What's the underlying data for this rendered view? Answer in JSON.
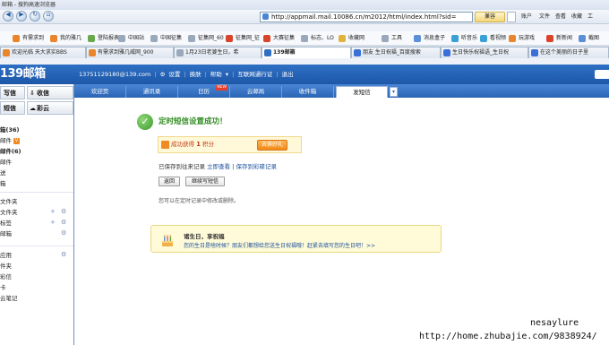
{
  "browser": {
    "window_title": "邮箱 - 搜狗高速浏览器",
    "address": "http://appmail.mail.10086.cn/m2012/html/index.html?sid=",
    "compat_label": "兼容",
    "menu": [
      "账户",
      "文件",
      "查看",
      "收藏",
      "工"
    ],
    "bookmarks": [
      "有需求到",
      "我的雅几",
      "登陆报表",
      "中国站",
      "中国征集",
      "征集网_60",
      "征集网_征",
      "大赛征集",
      "标志、LO",
      "收藏网",
      "工具",
      "消息盒子",
      "听音乐",
      "看视频",
      "玩游戏",
      "新新闻",
      "截图"
    ],
    "tabs": [
      "欢迎光临 天大求实BBS",
      "有需求到雅几威网_900",
      "1月23日老婆生日，希",
      "139邮箱",
      "朋友 生日祝福_百度搜索",
      "生日快乐祝福语_生日祝",
      "在这个美丽的日子里"
    ],
    "colors": {
      "accent": "#2f70c4",
      "success": "#3c9b2a"
    }
  },
  "mail": {
    "logo": "139邮箱",
    "account": "13751129180@139.com",
    "header_links": [
      "设置",
      "换肤",
      "帮助",
      "互联网通行证",
      "退出"
    ],
    "sidebar": {
      "write": "写信",
      "receive": "收信",
      "sms": "短信",
      "mms": "彩云",
      "folders": [
        "箱(36)",
        "邮件",
        "邮件(6)",
        "邮件",
        "送",
        "箱"
      ],
      "sections": [
        "文件夹",
        "文件夹",
        "标签",
        "邮箱"
      ],
      "apps_title": "应用",
      "apps": [
        "件夹",
        "彩信",
        "卡",
        "云笔记"
      ]
    },
    "module_tabs": [
      "欢迎页",
      "通讯录",
      "日历",
      "云邮局",
      "收件箱",
      "发短信"
    ],
    "new_badge": "NEW",
    "active_tab": "发短信",
    "content": {
      "success_title": "定时短信设置成功！",
      "reward_text": "成功获得",
      "reward_points": "1",
      "reward_unit": "积分",
      "reward_button": "去换好礼",
      "saved_text": "已保存到往来记录",
      "view_now": "立即查看",
      "save_to_notes": "保存到彩碟记录",
      "back_button": "返回",
      "continue_button": "继续写短信",
      "note": "您可以在定时记录中修改或删除。",
      "birthday_title": "诸生日，享祝福",
      "birthday_text": "您的生日是啥时候？朋友们都想给您送生日祝福哦！赶紧去填写您的生日吧！>>"
    }
  },
  "watermark": {
    "name": "nesaylure",
    "url": "http://home.zhubajie.com/9838924/"
  }
}
